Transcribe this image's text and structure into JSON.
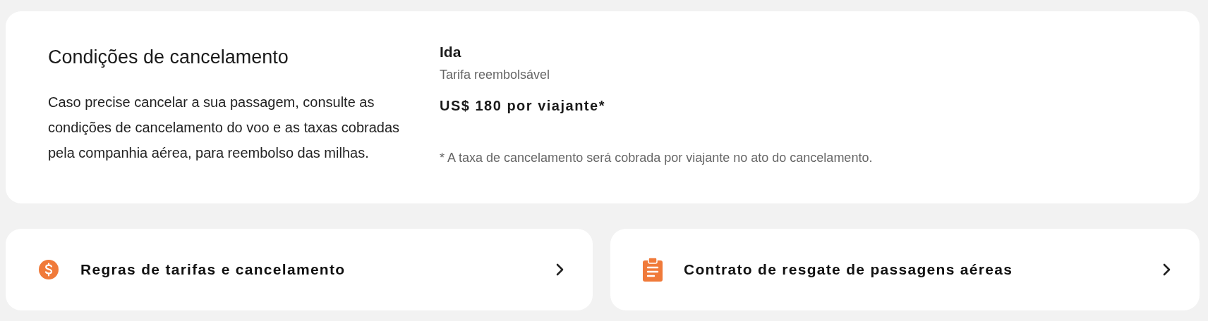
{
  "cancellation": {
    "title": "Condições de cancelamento",
    "description": "Caso precise cancelar a sua passagem, consulte as condições de cancelamento do voo e as taxas cobradas pela companhia aérea, para reembolso das milhas.",
    "segment": "Ida",
    "fare_type": "Tarifa reembolsável",
    "price": "US$ 180 por viajante*",
    "note": "* A taxa de cancelamento será cobrada por viajante no ato do cancelamento."
  },
  "links": [
    {
      "kind": "money",
      "label": "Regras de tarifas e cancelamento"
    },
    {
      "kind": "clipboard",
      "label": "Contrato de resgate de passagens aéreas"
    }
  ]
}
